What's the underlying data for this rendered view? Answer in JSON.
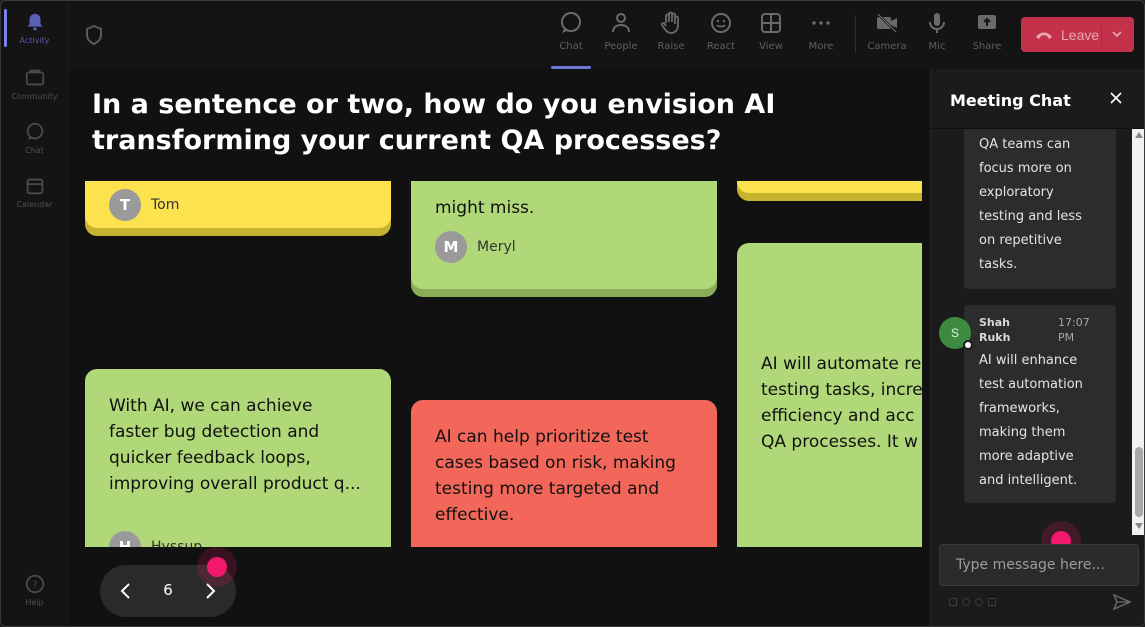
{
  "rail": {
    "items": [
      {
        "label": "Activity"
      },
      {
        "label": "Community"
      },
      {
        "label": "Chat"
      },
      {
        "label": "Calendar"
      },
      {
        "label": "Help"
      }
    ]
  },
  "toolbar": {
    "chat": "Chat",
    "people": "People",
    "raise": "Raise",
    "react": "React",
    "view": "View",
    "more": "More",
    "camera": "Camera",
    "mic": "Mic",
    "share": "Share",
    "leave": "Leave"
  },
  "question": "In a sentence or two, how do you envision AI transforming your current QA processes?",
  "cards": [
    {
      "id": "c1",
      "color": "yellow",
      "text": "",
      "author": "Tom",
      "initial": "T"
    },
    {
      "id": "c2",
      "color": "green",
      "text": "might miss.",
      "author": "Meryl",
      "initial": "M"
    },
    {
      "id": "c3",
      "color": "yellow",
      "text": "",
      "author": "",
      "initial": ""
    },
    {
      "id": "c4",
      "color": "green",
      "text": "AI will automate re testing tasks, incre efficiency and acc QA processes. It w",
      "author": "",
      "initial": ""
    },
    {
      "id": "c5",
      "color": "green",
      "text": "With AI, we can achieve faster bug detection and quicker feedback loops, improving overall product q...",
      "author": "Hyssup",
      "initial": "H"
    },
    {
      "id": "c6",
      "color": "red",
      "text": "AI can help prioritize test cases based on risk, making testing more targeted and effective.",
      "author": "",
      "initial": ""
    }
  ],
  "pager": {
    "page": "6"
  },
  "chat": {
    "title": "Meeting Chat",
    "messages": [
      {
        "text": "QA teams can focus more on exploratory testing and less on repetitive tasks."
      },
      {
        "sender": "Shah Rukh",
        "time": "17:07 PM",
        "avatar": "S",
        "text": "AI will enhance test automation frameworks, making them more adaptive and intelligent."
      }
    ],
    "placeholder": "Type message here..."
  },
  "colors": {
    "accent": "#7b83eb",
    "leave": "#c4314b",
    "yellow": "#fde24f",
    "green": "#b0d879",
    "red": "#f2675a",
    "pointer": "#f0196b"
  }
}
